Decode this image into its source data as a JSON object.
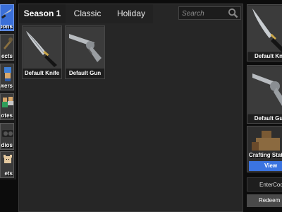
{
  "sidebar": {
    "items": [
      {
        "label": "pons",
        "icon": "knife-icon",
        "active": true
      },
      {
        "label": "ects",
        "icon": "effects-icon"
      },
      {
        "label": "wers",
        "icon": "powers-icon"
      },
      {
        "label": "otes",
        "icon": "emotes-icon"
      },
      {
        "label": "dios",
        "icon": "radios-icon"
      },
      {
        "label": "ets",
        "icon": "pets-icon"
      }
    ]
  },
  "tabs": [
    {
      "label": "Season 1",
      "active": true
    },
    {
      "label": "Classic"
    },
    {
      "label": "Holiday"
    }
  ],
  "search": {
    "placeholder": "Search"
  },
  "inventory": [
    {
      "name": "Default Knife",
      "icon": "knife-icon"
    },
    {
      "name": "Default Gun",
      "icon": "revolver-icon"
    }
  ],
  "equipped": {
    "knife_label": "Default Kn",
    "gun_label": "Default Gu"
  },
  "crafting": {
    "label": "Crafting Stat",
    "view_label": "View"
  },
  "code": {
    "placeholder": "EnterCode",
    "redeem_label": "Redeem"
  },
  "colors": {
    "accent": "#3a6fd8",
    "panel": "#262626",
    "background": "#0c0c0c"
  }
}
